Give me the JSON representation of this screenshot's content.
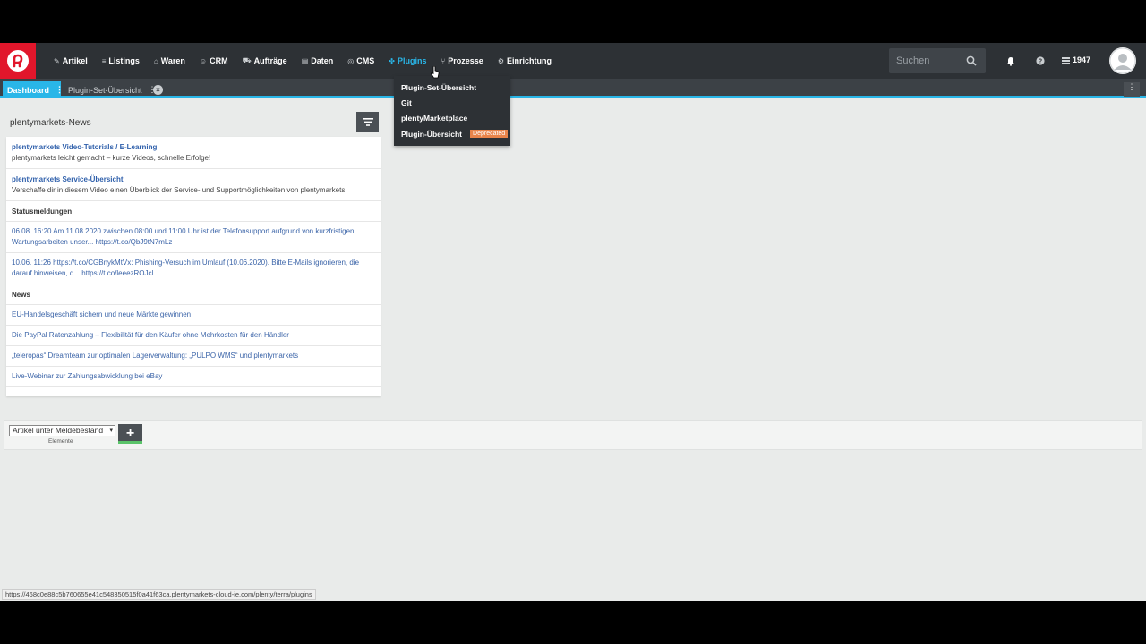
{
  "nav": {
    "items": [
      {
        "label": "Artikel",
        "icon": "tag-icon",
        "glyph": "✎"
      },
      {
        "label": "Listings",
        "icon": "list-icon",
        "glyph": "≡"
      },
      {
        "label": "Waren",
        "icon": "warehouse-icon",
        "glyph": "⌂"
      },
      {
        "label": "CRM",
        "icon": "users-icon",
        "glyph": "☺"
      },
      {
        "label": "Aufträge",
        "icon": "cart-icon",
        "glyph": "⛟"
      },
      {
        "label": "Daten",
        "icon": "data-icon",
        "glyph": "▤"
      },
      {
        "label": "CMS",
        "icon": "globe-icon",
        "glyph": "◎"
      },
      {
        "label": "Plugins",
        "icon": "puzzle-icon",
        "glyph": "✤"
      },
      {
        "label": "Prozesse",
        "icon": "process-icon",
        "glyph": "⑂"
      },
      {
        "label": "Einrichtung",
        "icon": "gear-icon",
        "glyph": "⚙"
      }
    ],
    "search_placeholder": "Suchen",
    "count": "1947",
    "accent": "#29b6e8",
    "brand": "#e1162b"
  },
  "tabs": {
    "dashboard": "Dashboard",
    "plugin_set": "Plugin-Set-Übersicht",
    "kebab": "⋮",
    "close": "×"
  },
  "plugins_menu": {
    "items": [
      "Plugin-Set-Übersicht",
      "Git",
      "plentyMarketplace",
      "Plugin-Übersicht"
    ],
    "deprecated_label": "Deprecated"
  },
  "news": {
    "title": "plentymarkets-News",
    "rows": [
      {
        "kind": "entry",
        "title": "plentymarkets Video-Tutorials / E-Learning",
        "sub": "plentymarkets leicht gemacht – kurze Videos, schnelle Erfolge!"
      },
      {
        "kind": "entry",
        "title": "plentymarkets Service-Übersicht",
        "sub": "Verschaffe dir in diesem Video einen Überblick der Service- und Supportmöglichkeiten von plentymarkets"
      },
      {
        "kind": "header",
        "text": "Statusmeldungen"
      },
      {
        "kind": "status",
        "text": "06.08. 16:20 Am 11.08.2020 zwischen 08:00 und 11:00 Uhr ist der Telefonsupport aufgrund von kurzfristigen Wartungsarbeiten unser... https://t.co/QbJ9tN7mLz"
      },
      {
        "kind": "status",
        "text": "10.06. 11:26 https://t.co/CGBnykMtVx: Phishing-Versuch im Umlauf (10.06.2020). Bitte E-Mails ignorieren, die darauf hinweisen, d... https://t.co/leeezROJcl"
      },
      {
        "kind": "header",
        "text": "News"
      },
      {
        "kind": "link",
        "text": "EU-Handelsgeschäft sichern und neue Märkte gewinnen"
      },
      {
        "kind": "link",
        "text": "Die PayPal Ratenzahlung – Flexibilität für den Käufer ohne Mehrkosten für den Händler"
      },
      {
        "kind": "link",
        "text": "„teleropas“ Dreamteam zur optimalen Lagerverwaltung: „PULPO WMS“ und plentymarkets"
      },
      {
        "kind": "link",
        "text": "Live-Webinar zur Zahlungsabwicklung bei eBay"
      }
    ]
  },
  "widget": {
    "select_value": "Artikel unter Meldebestand",
    "select_hint": "Elemente",
    "add_label": "+"
  },
  "status_url": "https://468c0e88c5b760655e41c548350515f0a41f63ca.plentymarkets-cloud-ie.com/plenty/terra/plugins"
}
